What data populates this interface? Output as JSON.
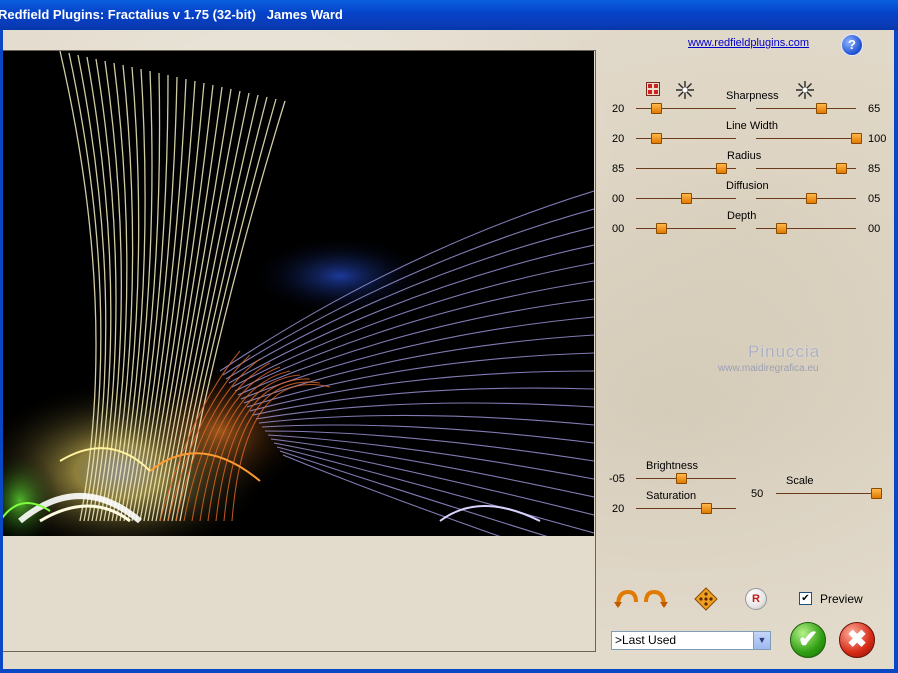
{
  "window": {
    "title": "Redfield Plugins: Fractalius v 1.75 (32-bit)   James Ward"
  },
  "header": {
    "link": "www.redfieldplugins.com",
    "help_glyph": "?"
  },
  "sliders": [
    {
      "label": "Sharpness",
      "left_value": "20",
      "right_value": "65",
      "left_pos": 0.2,
      "right_pos": 0.65
    },
    {
      "label": "Line Width",
      "left_value": "20",
      "right_value": "100",
      "left_pos": 0.2,
      "right_pos": 1.0
    },
    {
      "label": "Radius",
      "left_value": "85",
      "right_value": "85",
      "left_pos": 0.85,
      "right_pos": 0.85
    },
    {
      "label": "Diffusion",
      "left_value": "00",
      "right_value": "05",
      "left_pos": 0.5,
      "right_pos": 0.55
    },
    {
      "label": "Depth",
      "left_value": "00",
      "right_value": "00",
      "left_pos": 0.25,
      "right_pos": 0.25
    }
  ],
  "adjust": {
    "brightness": {
      "label": "Brightness",
      "value": "-05",
      "pos": 0.45
    },
    "saturation": {
      "label": "Saturation",
      "value": "20",
      "pos": 0.7
    },
    "scale": {
      "label": "Scale",
      "value": "50",
      "pos": 1.0
    }
  },
  "watermark": {
    "name": "Pinuccia",
    "site": "www.maidiregrafica.eu"
  },
  "preview": {
    "label": "Preview",
    "checked": "✔"
  },
  "preset": {
    "selected": ">Last Used"
  },
  "buttons": {
    "ok_glyph": "✔",
    "cancel_glyph": "✖"
  },
  "icons": {
    "reset_glyph": "R"
  },
  "colors": {
    "title_bar": "#0542c8",
    "slider_thumb": "#e07a00",
    "ok": "#2f9e12",
    "cancel": "#d62a16"
  }
}
